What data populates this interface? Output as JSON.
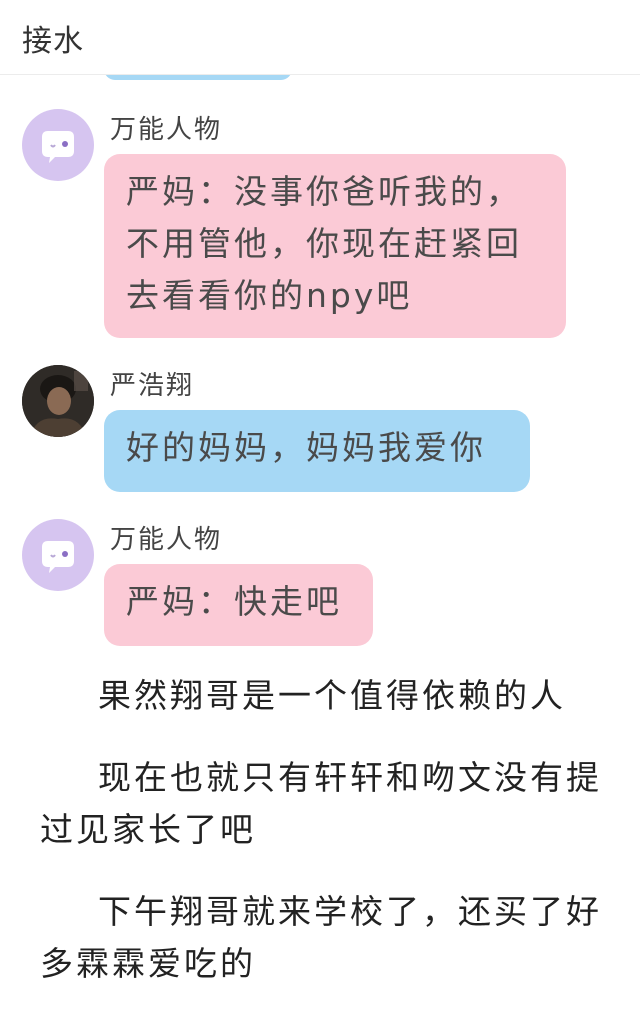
{
  "header": {
    "title": "接水"
  },
  "colors": {
    "pink_bubble": "#fbcad6",
    "blue_bubble": "#a6d8f5",
    "purple_avatar": "#d6c5f0"
  },
  "messages": [
    {
      "sender": "万能人物",
      "avatar": "ghost-face-icon",
      "text": "严妈：没事你爸听我的，不用管他，你现在赶紧回去看看你的npy吧"
    },
    {
      "sender": "严浩翔",
      "avatar": "user-photo",
      "text": "好的妈妈，妈妈我爱你"
    },
    {
      "sender": "万能人物",
      "avatar": "ghost-face-icon",
      "text": "严妈：快走吧"
    }
  ],
  "paragraphs": [
    "果然翔哥是一个值得依赖的人",
    "现在也就只有轩轩和吻文没有提过见家长了吧",
    "下午翔哥就来学校了，还买了好多霖霖爱吃的"
  ]
}
